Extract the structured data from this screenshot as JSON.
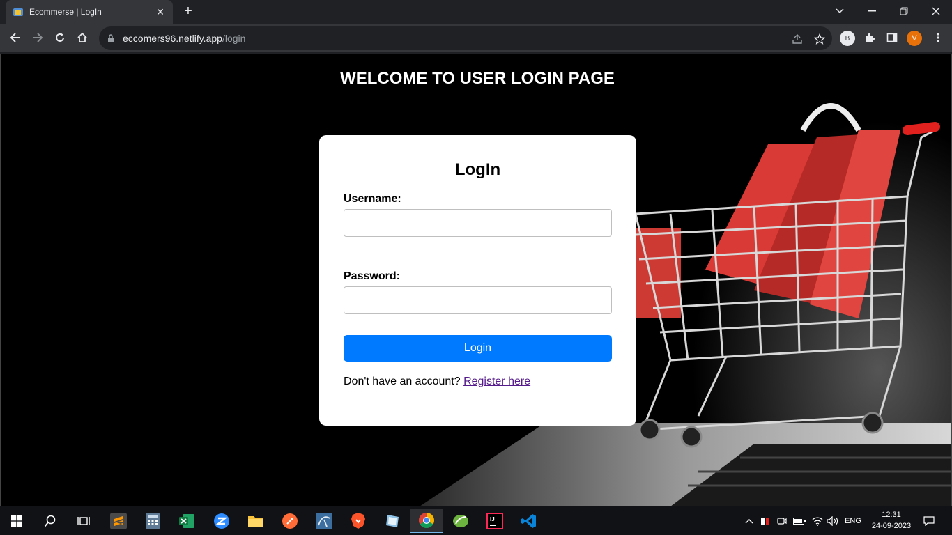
{
  "browser": {
    "tab": {
      "title": "Ecommerse | LogIn",
      "favicon": "ecommerce-favicon"
    },
    "address": {
      "host": "eccomers96.netlify.app",
      "path": "/login"
    },
    "profiles": [
      {
        "letter": "B"
      },
      {
        "letter": "V"
      }
    ],
    "colors": {
      "frame": "#202124",
      "toolbar": "#35363a",
      "profile_v": "#e8710a"
    }
  },
  "page": {
    "heading": "WELCOME TO USER LOGIN PAGE",
    "form": {
      "title": "LogIn",
      "username_label": "Username:",
      "username_value": "",
      "password_label": "Password:",
      "password_value": "",
      "submit_label": "Login",
      "register_prompt": "Don't have an account?",
      "register_link": "Register here"
    },
    "colors": {
      "button": "#007bff",
      "link": "#551a8b"
    }
  },
  "taskbar": {
    "apps": [
      "sublime-text-icon",
      "calculator-icon",
      "excel-icon",
      "zoom-icon",
      "file-explorer-icon",
      "postman-icon",
      "mysql-workbench-icon",
      "brave-icon",
      "notepad-icon",
      "chrome-icon",
      "spring-tool-suite-icon",
      "intellij-icon",
      "vscode-icon"
    ],
    "active_app": "chrome-icon",
    "language": "ENG",
    "time": "12:31",
    "date": "24-09-2023"
  }
}
